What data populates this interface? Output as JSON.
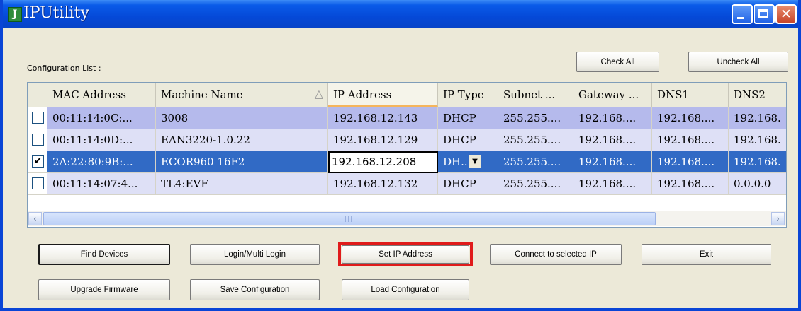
{
  "window": {
    "title": "IPUtility"
  },
  "config": {
    "label": "Configuration List :",
    "check_all": "Check All",
    "uncheck_all": "Uncheck All"
  },
  "table": {
    "columns": [
      "MAC Address",
      "Machine Name",
      "IP Address",
      "IP Type",
      "Subnet ...",
      "Gateway ...",
      "DNS1",
      "DNS2"
    ],
    "sort_icon": "△",
    "rows": [
      {
        "checked": false,
        "check_glyph": "",
        "mac": "00:11:14:0C:...",
        "name": "3008",
        "ip": "192.168.12.143",
        "type": "DHCP",
        "subnet": "255.255....",
        "gateway": "192.168....",
        "dns1": "192.168....",
        "dns2": "192.168."
      },
      {
        "checked": false,
        "check_glyph": "",
        "mac": "00:11:14:0D:...",
        "name": "EAN3220-1.0.22",
        "ip": "192.168.12.129",
        "type": "DHCP",
        "subnet": "255.255....",
        "gateway": "192.168....",
        "dns1": "192.168....",
        "dns2": "192.168."
      },
      {
        "checked": true,
        "check_glyph": "✔",
        "mac": "2A:22:80:9B:...",
        "name": "ECOR960 16F2",
        "ip": "192.168.12.208",
        "type": "DH...",
        "subnet": "255.255....",
        "gateway": "192.168....",
        "dns1": "192.168....",
        "dns2": "192.168."
      },
      {
        "checked": false,
        "check_glyph": "",
        "mac": "00:11:14:07:4...",
        "name": "TL4:EVF",
        "ip": "192.168.12.132",
        "type": "DHCP",
        "subnet": "255.255....",
        "gateway": "192.168....",
        "dns1": "192.168....",
        "dns2": "0.0.0.0"
      }
    ]
  },
  "scrollbar": {
    "left_arrow": "‹",
    "right_arrow": "›",
    "grip": "|||"
  },
  "dropdown_glyph": "▼",
  "buttons": {
    "find_devices": "Find Devices",
    "login": "Login/Multi Login",
    "set_ip": "Set IP Address",
    "connect": "Connect to selected IP",
    "exit": "Exit",
    "upgrade": "Upgrade Firmware",
    "save": "Save Configuration",
    "load": "Load Configuration"
  },
  "colors": {
    "title_bar": "#0A5BE8",
    "selected_row": "#316AC5",
    "highlight": "#E01B1B"
  }
}
